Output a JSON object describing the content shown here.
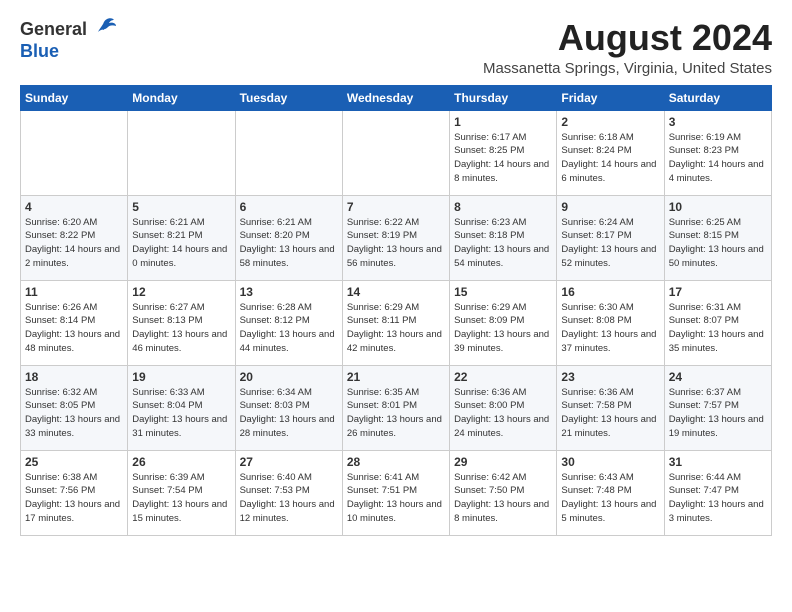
{
  "header": {
    "logo_general": "General",
    "logo_blue": "Blue",
    "month_year": "August 2024",
    "location": "Massanetta Springs, Virginia, United States"
  },
  "weekdays": [
    "Sunday",
    "Monday",
    "Tuesday",
    "Wednesday",
    "Thursday",
    "Friday",
    "Saturday"
  ],
  "weeks": [
    [
      {
        "day": "",
        "sunrise": "",
        "sunset": "",
        "daylight": ""
      },
      {
        "day": "",
        "sunrise": "",
        "sunset": "",
        "daylight": ""
      },
      {
        "day": "",
        "sunrise": "",
        "sunset": "",
        "daylight": ""
      },
      {
        "day": "",
        "sunrise": "",
        "sunset": "",
        "daylight": ""
      },
      {
        "day": "1",
        "sunrise": "Sunrise: 6:17 AM",
        "sunset": "Sunset: 8:25 PM",
        "daylight": "Daylight: 14 hours and 8 minutes."
      },
      {
        "day": "2",
        "sunrise": "Sunrise: 6:18 AM",
        "sunset": "Sunset: 8:24 PM",
        "daylight": "Daylight: 14 hours and 6 minutes."
      },
      {
        "day": "3",
        "sunrise": "Sunrise: 6:19 AM",
        "sunset": "Sunset: 8:23 PM",
        "daylight": "Daylight: 14 hours and 4 minutes."
      }
    ],
    [
      {
        "day": "4",
        "sunrise": "Sunrise: 6:20 AM",
        "sunset": "Sunset: 8:22 PM",
        "daylight": "Daylight: 14 hours and 2 minutes."
      },
      {
        "day": "5",
        "sunrise": "Sunrise: 6:21 AM",
        "sunset": "Sunset: 8:21 PM",
        "daylight": "Daylight: 14 hours and 0 minutes."
      },
      {
        "day": "6",
        "sunrise": "Sunrise: 6:21 AM",
        "sunset": "Sunset: 8:20 PM",
        "daylight": "Daylight: 13 hours and 58 minutes."
      },
      {
        "day": "7",
        "sunrise": "Sunrise: 6:22 AM",
        "sunset": "Sunset: 8:19 PM",
        "daylight": "Daylight: 13 hours and 56 minutes."
      },
      {
        "day": "8",
        "sunrise": "Sunrise: 6:23 AM",
        "sunset": "Sunset: 8:18 PM",
        "daylight": "Daylight: 13 hours and 54 minutes."
      },
      {
        "day": "9",
        "sunrise": "Sunrise: 6:24 AM",
        "sunset": "Sunset: 8:17 PM",
        "daylight": "Daylight: 13 hours and 52 minutes."
      },
      {
        "day": "10",
        "sunrise": "Sunrise: 6:25 AM",
        "sunset": "Sunset: 8:15 PM",
        "daylight": "Daylight: 13 hours and 50 minutes."
      }
    ],
    [
      {
        "day": "11",
        "sunrise": "Sunrise: 6:26 AM",
        "sunset": "Sunset: 8:14 PM",
        "daylight": "Daylight: 13 hours and 48 minutes."
      },
      {
        "day": "12",
        "sunrise": "Sunrise: 6:27 AM",
        "sunset": "Sunset: 8:13 PM",
        "daylight": "Daylight: 13 hours and 46 minutes."
      },
      {
        "day": "13",
        "sunrise": "Sunrise: 6:28 AM",
        "sunset": "Sunset: 8:12 PM",
        "daylight": "Daylight: 13 hours and 44 minutes."
      },
      {
        "day": "14",
        "sunrise": "Sunrise: 6:29 AM",
        "sunset": "Sunset: 8:11 PM",
        "daylight": "Daylight: 13 hours and 42 minutes."
      },
      {
        "day": "15",
        "sunrise": "Sunrise: 6:29 AM",
        "sunset": "Sunset: 8:09 PM",
        "daylight": "Daylight: 13 hours and 39 minutes."
      },
      {
        "day": "16",
        "sunrise": "Sunrise: 6:30 AM",
        "sunset": "Sunset: 8:08 PM",
        "daylight": "Daylight: 13 hours and 37 minutes."
      },
      {
        "day": "17",
        "sunrise": "Sunrise: 6:31 AM",
        "sunset": "Sunset: 8:07 PM",
        "daylight": "Daylight: 13 hours and 35 minutes."
      }
    ],
    [
      {
        "day": "18",
        "sunrise": "Sunrise: 6:32 AM",
        "sunset": "Sunset: 8:05 PM",
        "daylight": "Daylight: 13 hours and 33 minutes."
      },
      {
        "day": "19",
        "sunrise": "Sunrise: 6:33 AM",
        "sunset": "Sunset: 8:04 PM",
        "daylight": "Daylight: 13 hours and 31 minutes."
      },
      {
        "day": "20",
        "sunrise": "Sunrise: 6:34 AM",
        "sunset": "Sunset: 8:03 PM",
        "daylight": "Daylight: 13 hours and 28 minutes."
      },
      {
        "day": "21",
        "sunrise": "Sunrise: 6:35 AM",
        "sunset": "Sunset: 8:01 PM",
        "daylight": "Daylight: 13 hours and 26 minutes."
      },
      {
        "day": "22",
        "sunrise": "Sunrise: 6:36 AM",
        "sunset": "Sunset: 8:00 PM",
        "daylight": "Daylight: 13 hours and 24 minutes."
      },
      {
        "day": "23",
        "sunrise": "Sunrise: 6:36 AM",
        "sunset": "Sunset: 7:58 PM",
        "daylight": "Daylight: 13 hours and 21 minutes."
      },
      {
        "day": "24",
        "sunrise": "Sunrise: 6:37 AM",
        "sunset": "Sunset: 7:57 PM",
        "daylight": "Daylight: 13 hours and 19 minutes."
      }
    ],
    [
      {
        "day": "25",
        "sunrise": "Sunrise: 6:38 AM",
        "sunset": "Sunset: 7:56 PM",
        "daylight": "Daylight: 13 hours and 17 minutes."
      },
      {
        "day": "26",
        "sunrise": "Sunrise: 6:39 AM",
        "sunset": "Sunset: 7:54 PM",
        "daylight": "Daylight: 13 hours and 15 minutes."
      },
      {
        "day": "27",
        "sunrise": "Sunrise: 6:40 AM",
        "sunset": "Sunset: 7:53 PM",
        "daylight": "Daylight: 13 hours and 12 minutes."
      },
      {
        "day": "28",
        "sunrise": "Sunrise: 6:41 AM",
        "sunset": "Sunset: 7:51 PM",
        "daylight": "Daylight: 13 hours and 10 minutes."
      },
      {
        "day": "29",
        "sunrise": "Sunrise: 6:42 AM",
        "sunset": "Sunset: 7:50 PM",
        "daylight": "Daylight: 13 hours and 8 minutes."
      },
      {
        "day": "30",
        "sunrise": "Sunrise: 6:43 AM",
        "sunset": "Sunset: 7:48 PM",
        "daylight": "Daylight: 13 hours and 5 minutes."
      },
      {
        "day": "31",
        "sunrise": "Sunrise: 6:44 AM",
        "sunset": "Sunset: 7:47 PM",
        "daylight": "Daylight: 13 hours and 3 minutes."
      }
    ]
  ]
}
